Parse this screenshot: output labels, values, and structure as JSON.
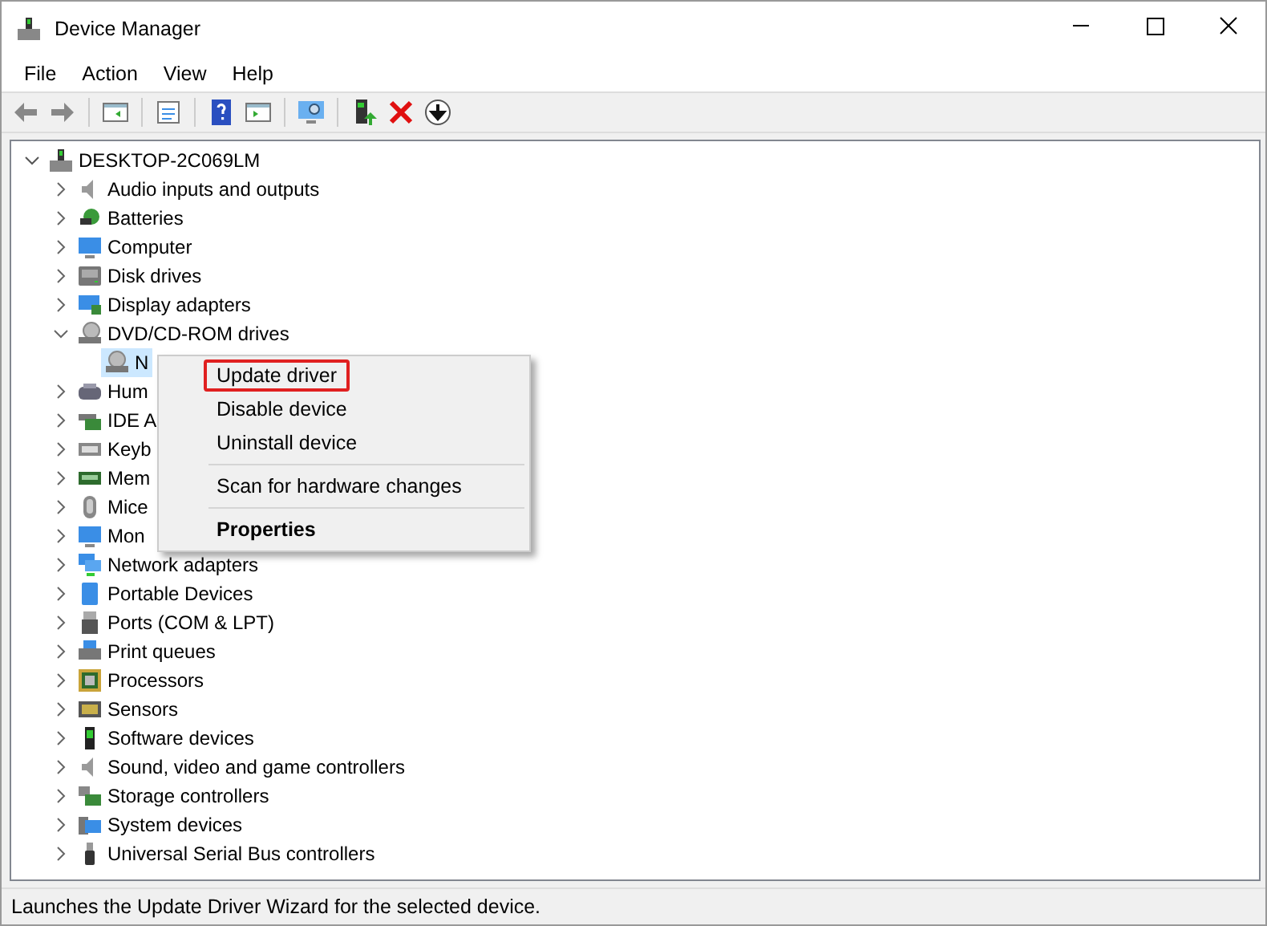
{
  "window": {
    "title": "Device Manager"
  },
  "menu_bar": [
    "File",
    "Action",
    "View",
    "Help"
  ],
  "tree": {
    "label": "DESKTOP-2C069LM",
    "expanded": true,
    "children": [
      {
        "label": "Audio inputs and outputs",
        "expanded": false
      },
      {
        "label": "Batteries",
        "expanded": false
      },
      {
        "label": "Computer",
        "expanded": false
      },
      {
        "label": "Disk drives",
        "expanded": false
      },
      {
        "label": "Display adapters",
        "expanded": false
      },
      {
        "label": "DVD/CD-ROM drives",
        "expanded": true,
        "children": [
          {
            "label": "N",
            "selected": true
          }
        ]
      },
      {
        "label": "Hum",
        "expanded": false
      },
      {
        "label": "IDE A",
        "expanded": false
      },
      {
        "label": "Keyb",
        "expanded": false
      },
      {
        "label": "Mem",
        "expanded": false
      },
      {
        "label": "Mice",
        "expanded": false
      },
      {
        "label": "Mon",
        "expanded": false
      },
      {
        "label": "Network adapters",
        "expanded": false
      },
      {
        "label": "Portable Devices",
        "expanded": false
      },
      {
        "label": "Ports (COM & LPT)",
        "expanded": false
      },
      {
        "label": "Print queues",
        "expanded": false
      },
      {
        "label": "Processors",
        "expanded": false
      },
      {
        "label": "Sensors",
        "expanded": false
      },
      {
        "label": "Software devices",
        "expanded": false
      },
      {
        "label": "Sound, video and game controllers",
        "expanded": false
      },
      {
        "label": "Storage controllers",
        "expanded": false
      },
      {
        "label": "System devices",
        "expanded": false
      },
      {
        "label": "Universal Serial Bus controllers",
        "expanded": false
      }
    ]
  },
  "context_menu": [
    {
      "kind": "item",
      "label": "Update driver",
      "selected": true
    },
    {
      "kind": "item",
      "label": "Disable device",
      "selected": false
    },
    {
      "kind": "item",
      "label": "Uninstall device",
      "selected": false
    },
    {
      "kind": "separator"
    },
    {
      "kind": "item",
      "label": "Scan for hardware changes",
      "selected": false
    },
    {
      "kind": "separator"
    },
    {
      "kind": "default",
      "label": "Properties",
      "selected": false
    }
  ],
  "status_bar": "Launches the Update Driver Wizard for the selected device."
}
